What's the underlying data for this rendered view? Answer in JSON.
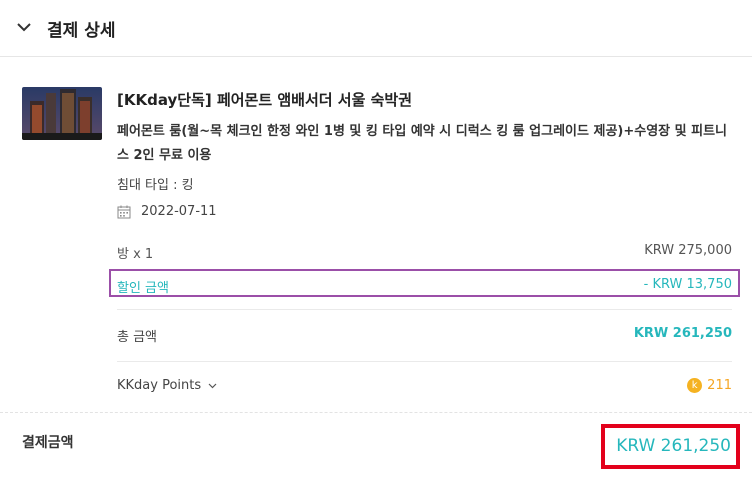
{
  "header": {
    "title": "결제 상세"
  },
  "product": {
    "title": "[KKday단독] 페어몬트 앰배서더 서울 숙박권",
    "package": "페어몬트 룸(월~목 체크인 한정 와인 1병 및 킹 타입 예약 시 디럭스 킹 룸 업그레이드 제공)+수영장 및 피트니스 2인 무료 이용",
    "bed_type": "침대 타입 : 킹",
    "date": "2022-07-11"
  },
  "rows": {
    "room_label": "방 x 1",
    "room_price": "KRW 275,000",
    "discount_label": "할인 금액",
    "discount_value": "- KRW 13,750",
    "total_label": "총 금액",
    "total_value": "KRW 261,250",
    "points_label": "KKday Points",
    "points_coin": "k",
    "points_value": "211"
  },
  "payment": {
    "label": "결제금액",
    "value": "KRW 261,250"
  },
  "colors": {
    "accent": "#26b7bc",
    "points": "#f5a623",
    "highlight_discount": "#9b4fa8",
    "highlight_pay": "#e3001b"
  }
}
